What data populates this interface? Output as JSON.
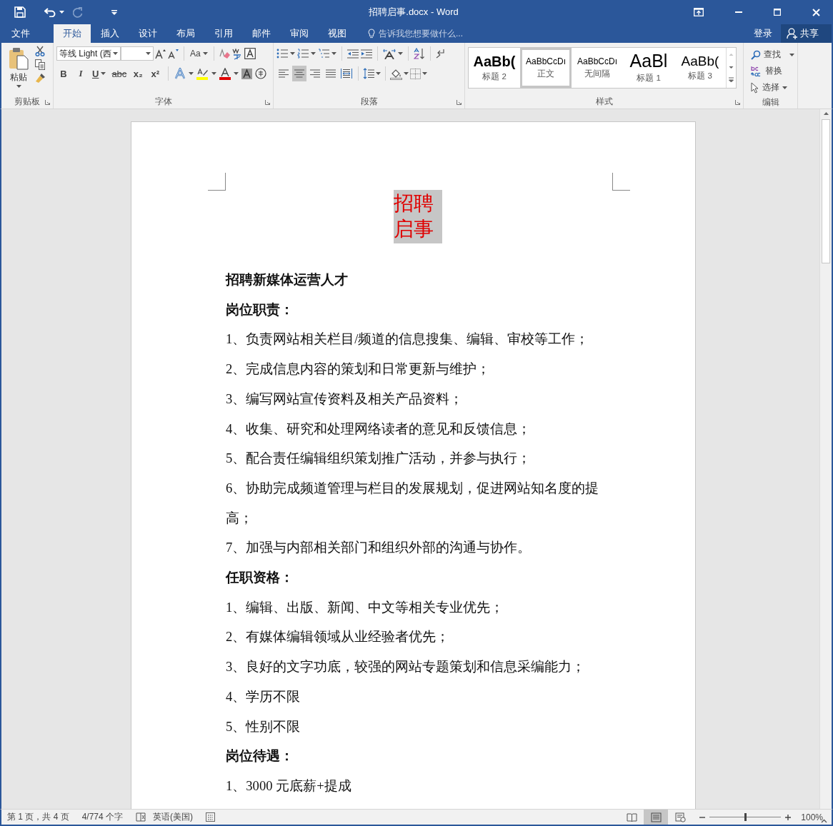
{
  "title_bar": {
    "title": "招聘启事.docx - Word"
  },
  "tabs": [
    {
      "label": "文件",
      "selected": false
    },
    {
      "label": "开始",
      "selected": true
    },
    {
      "label": "插入",
      "selected": false
    },
    {
      "label": "设计",
      "selected": false
    },
    {
      "label": "布局",
      "selected": false
    },
    {
      "label": "引用",
      "selected": false
    },
    {
      "label": "邮件",
      "selected": false
    },
    {
      "label": "审阅",
      "selected": false
    },
    {
      "label": "视图",
      "selected": false
    }
  ],
  "tell_me": {
    "placeholder": "告诉我您想要做什么..."
  },
  "account": {
    "sign_in": "登录",
    "share": "共享"
  },
  "ribbon": {
    "clipboard": {
      "paste": "粘贴",
      "group": "剪贴板"
    },
    "font": {
      "font_name": "等线 Light (西",
      "format_buttons": [
        "B",
        "I",
        "U",
        "abc",
        "x₂",
        "x²"
      ],
      "change_case": "Aa",
      "group": "字体"
    },
    "paragraph": {
      "alignments": [
        {
          "selected": false
        },
        {
          "selected": true
        },
        {
          "selected": false
        },
        {
          "selected": false
        },
        {
          "selected": false
        }
      ],
      "group": "段落"
    },
    "styles": {
      "items": [
        {
          "preview": "AaBb(",
          "name": "标题 2",
          "kind": "heading2",
          "selected": false
        },
        {
          "preview": "AaBbCcDı",
          "name": "正文",
          "kind": "normal",
          "selected": true
        },
        {
          "preview": "AaBbCcDı",
          "name": "无间隔",
          "kind": "normal",
          "selected": false
        },
        {
          "preview": "AaBl",
          "name": "标题 1",
          "kind": "heading1",
          "selected": false
        },
        {
          "preview": "AaBb(",
          "name": "标题 3",
          "kind": "heading3",
          "selected": false
        }
      ],
      "group": "样式"
    },
    "editing": {
      "find": "查找",
      "replace": "替换",
      "select": "选择",
      "group": "编辑"
    }
  },
  "document": {
    "title": "招聘启事",
    "paragraphs": [
      {
        "kind": "heading",
        "text": "招聘新媒体运营人才"
      },
      {
        "kind": "heading",
        "text": "岗位职责："
      },
      {
        "kind": "item",
        "text": "1、负责网站相关栏目/频道的信息搜集、编辑、审校等工作；"
      },
      {
        "kind": "item",
        "text": "2、完成信息内容的策划和日常更新与维护；"
      },
      {
        "kind": "item",
        "text": "3、编写网站宣传资料及相关产品资料；"
      },
      {
        "kind": "item",
        "text": "4、收集、研究和处理网络读者的意见和反馈信息；"
      },
      {
        "kind": "item",
        "text": "5、配合责任编辑组织策划推广活动，并参与执行；"
      },
      {
        "kind": "item",
        "text": "6、协助完成频道管理与栏目的发展规划，促进网站知名度的提高；"
      },
      {
        "kind": "item",
        "text": "7、加强与内部相关部门和组织外部的沟通与协作。"
      },
      {
        "kind": "heading",
        "text": "任职资格："
      },
      {
        "kind": "item",
        "text": "1、编辑、出版、新闻、中文等相关专业优先；"
      },
      {
        "kind": "item",
        "text": "2、有媒体编辑领域从业经验者优先；"
      },
      {
        "kind": "item",
        "text": "3、良好的文字功底，较强的网站专题策划和信息采编能力；"
      },
      {
        "kind": "item",
        "text": "4、学历不限"
      },
      {
        "kind": "item",
        "text": "5、性别不限"
      },
      {
        "kind": "heading",
        "text": "岗位待遇："
      },
      {
        "kind": "item",
        "text": "1、3000 元底薪+提成"
      }
    ]
  },
  "status_bar": {
    "page": "第 1 页，共 4 页",
    "words": "4/774 个字",
    "language": "英语(美国)",
    "views": [
      {
        "kind": "read",
        "selected": false
      },
      {
        "kind": "print",
        "selected": true
      },
      {
        "kind": "web",
        "selected": false
      }
    ],
    "zoom": {
      "level": 0.5,
      "label": "100%"
    }
  }
}
